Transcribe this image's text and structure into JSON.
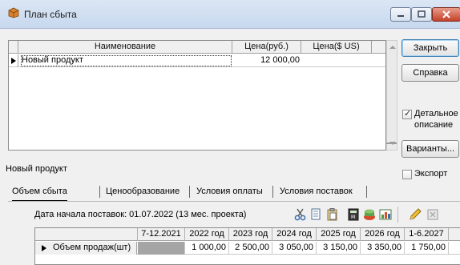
{
  "window": {
    "title": "План сбыта"
  },
  "top_grid": {
    "columns": [
      "Наименование",
      "Цена(руб.)",
      "Цена($ US)"
    ],
    "rows": [
      {
        "name": "Новый продукт",
        "price_rub": "12 000,00",
        "price_usd": ""
      }
    ]
  },
  "buttons": {
    "close": "Закрыть",
    "help": "Справка",
    "variants": "Варианты..."
  },
  "checkboxes": {
    "detail_line1": "Детальное",
    "detail_line2": "описание",
    "detail_checked": true,
    "export": "Экспорт",
    "export_checked": false
  },
  "detail": {
    "product_label": "Новый продукт",
    "tabs": [
      "Объем сбыта",
      "Ценообразование",
      "Условия оплаты",
      "Условия поставок"
    ],
    "active_tab": 0,
    "start_date": "Дата начала поставок:  01.07.2022 (13 мес. проекта)"
  },
  "toolbar_icons": [
    "scissors-icon",
    "copy-icon",
    "paste-icon",
    "calc-icon",
    "fill-icon",
    "chart-icon",
    "pencil-icon",
    "clear-icon"
  ],
  "volume_grid": {
    "columns": [
      "",
      "7-12.2021",
      "2022 год",
      "2023 год",
      "2024 год",
      "2025 год",
      "2026 год",
      "1-6.2027"
    ],
    "rows": [
      {
        "label": "Объем продаж(шт)",
        "values": [
          "",
          "1 000,00",
          "2 500,00",
          "3 050,00",
          "3 150,00",
          "3 350,00",
          "1 750,00"
        ]
      }
    ]
  }
}
